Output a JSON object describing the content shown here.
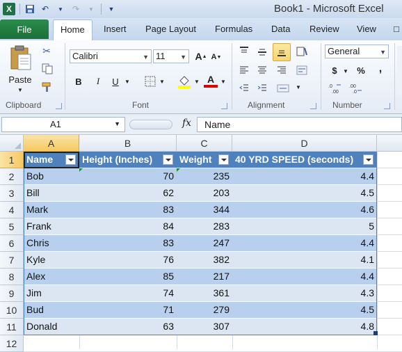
{
  "app": {
    "title": "Book1  -  Microsoft Excel",
    "icon": "excel-icon"
  },
  "quick_access": [
    "save-icon",
    "undo-icon",
    "redo-icon",
    "customize-qat-icon"
  ],
  "tabs": {
    "file": "File",
    "items": [
      "Home",
      "Insert",
      "Page Layout",
      "Formulas",
      "Data",
      "Review",
      "View"
    ],
    "active": "Home"
  },
  "ribbon": {
    "clipboard": {
      "label": "Clipboard",
      "paste": "Paste"
    },
    "font": {
      "label": "Font",
      "name": "Calibri",
      "size": "11",
      "bold": "B",
      "italic": "I",
      "underline": "U",
      "grow": "A",
      "shrink": "A",
      "font_color": "A",
      "fill_color": "#ffff00",
      "text_color": "#e00000"
    },
    "alignment": {
      "label": "Alignment"
    },
    "number": {
      "label": "Number",
      "format": "General",
      "currency": "$",
      "percent": "%",
      "comma": ",",
      "inc_decimal": ".0→.00",
      "dec_decimal": ".00→.0"
    }
  },
  "formula_bar": {
    "name_box": "A1",
    "fx": "fx",
    "content": "Name"
  },
  "sheet": {
    "columns": [
      "A",
      "B",
      "C",
      "D"
    ],
    "rows": [
      "1",
      "2",
      "3",
      "4",
      "5",
      "6",
      "7",
      "8",
      "9",
      "10",
      "11",
      "12"
    ],
    "headers": [
      "Name",
      "Height (Inches)",
      "Weight",
      "40 YRD SPEED (seconds)"
    ],
    "data": [
      [
        "Bob",
        "70",
        "235",
        "4.4"
      ],
      [
        "Bill",
        "62",
        "203",
        "4.5"
      ],
      [
        "Mark",
        "83",
        "344",
        "4.6"
      ],
      [
        "Frank",
        "84",
        "283",
        "5"
      ],
      [
        "Chris",
        "83",
        "247",
        "4.4"
      ],
      [
        "Kyle",
        "76",
        "382",
        "4.1"
      ],
      [
        "Alex",
        "85",
        "217",
        "4.4"
      ],
      [
        "Jim",
        "74",
        "361",
        "4.3"
      ],
      [
        "Bud",
        "71",
        "279",
        "4.5"
      ],
      [
        "Donald",
        "63",
        "307",
        "4.8"
      ]
    ],
    "table_header_color": "#4f81bd",
    "band_colors": [
      "#b8d0ee",
      "#dce6f3"
    ],
    "selection_color": "#f6c962"
  }
}
